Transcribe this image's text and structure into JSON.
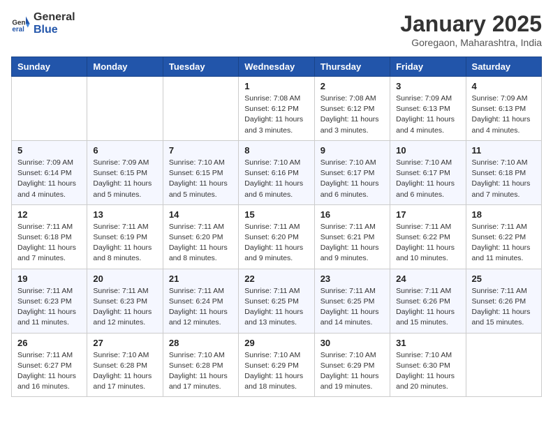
{
  "logo": {
    "general": "General",
    "blue": "Blue"
  },
  "title": "January 2025",
  "subtitle": "Goregaon, Maharashtra, India",
  "days_of_week": [
    "Sunday",
    "Monday",
    "Tuesday",
    "Wednesday",
    "Thursday",
    "Friday",
    "Saturday"
  ],
  "weeks": [
    [
      {
        "day": "",
        "info": ""
      },
      {
        "day": "",
        "info": ""
      },
      {
        "day": "",
        "info": ""
      },
      {
        "day": "1",
        "info": "Sunrise: 7:08 AM\nSunset: 6:12 PM\nDaylight: 11 hours and 3 minutes."
      },
      {
        "day": "2",
        "info": "Sunrise: 7:08 AM\nSunset: 6:12 PM\nDaylight: 11 hours and 3 minutes."
      },
      {
        "day": "3",
        "info": "Sunrise: 7:09 AM\nSunset: 6:13 PM\nDaylight: 11 hours and 4 minutes."
      },
      {
        "day": "4",
        "info": "Sunrise: 7:09 AM\nSunset: 6:13 PM\nDaylight: 11 hours and 4 minutes."
      }
    ],
    [
      {
        "day": "5",
        "info": "Sunrise: 7:09 AM\nSunset: 6:14 PM\nDaylight: 11 hours and 4 minutes."
      },
      {
        "day": "6",
        "info": "Sunrise: 7:09 AM\nSunset: 6:15 PM\nDaylight: 11 hours and 5 minutes."
      },
      {
        "day": "7",
        "info": "Sunrise: 7:10 AM\nSunset: 6:15 PM\nDaylight: 11 hours and 5 minutes."
      },
      {
        "day": "8",
        "info": "Sunrise: 7:10 AM\nSunset: 6:16 PM\nDaylight: 11 hours and 6 minutes."
      },
      {
        "day": "9",
        "info": "Sunrise: 7:10 AM\nSunset: 6:17 PM\nDaylight: 11 hours and 6 minutes."
      },
      {
        "day": "10",
        "info": "Sunrise: 7:10 AM\nSunset: 6:17 PM\nDaylight: 11 hours and 6 minutes."
      },
      {
        "day": "11",
        "info": "Sunrise: 7:10 AM\nSunset: 6:18 PM\nDaylight: 11 hours and 7 minutes."
      }
    ],
    [
      {
        "day": "12",
        "info": "Sunrise: 7:11 AM\nSunset: 6:18 PM\nDaylight: 11 hours and 7 minutes."
      },
      {
        "day": "13",
        "info": "Sunrise: 7:11 AM\nSunset: 6:19 PM\nDaylight: 11 hours and 8 minutes."
      },
      {
        "day": "14",
        "info": "Sunrise: 7:11 AM\nSunset: 6:20 PM\nDaylight: 11 hours and 8 minutes."
      },
      {
        "day": "15",
        "info": "Sunrise: 7:11 AM\nSunset: 6:20 PM\nDaylight: 11 hours and 9 minutes."
      },
      {
        "day": "16",
        "info": "Sunrise: 7:11 AM\nSunset: 6:21 PM\nDaylight: 11 hours and 9 minutes."
      },
      {
        "day": "17",
        "info": "Sunrise: 7:11 AM\nSunset: 6:22 PM\nDaylight: 11 hours and 10 minutes."
      },
      {
        "day": "18",
        "info": "Sunrise: 7:11 AM\nSunset: 6:22 PM\nDaylight: 11 hours and 11 minutes."
      }
    ],
    [
      {
        "day": "19",
        "info": "Sunrise: 7:11 AM\nSunset: 6:23 PM\nDaylight: 11 hours and 11 minutes."
      },
      {
        "day": "20",
        "info": "Sunrise: 7:11 AM\nSunset: 6:23 PM\nDaylight: 11 hours and 12 minutes."
      },
      {
        "day": "21",
        "info": "Sunrise: 7:11 AM\nSunset: 6:24 PM\nDaylight: 11 hours and 12 minutes."
      },
      {
        "day": "22",
        "info": "Sunrise: 7:11 AM\nSunset: 6:25 PM\nDaylight: 11 hours and 13 minutes."
      },
      {
        "day": "23",
        "info": "Sunrise: 7:11 AM\nSunset: 6:25 PM\nDaylight: 11 hours and 14 minutes."
      },
      {
        "day": "24",
        "info": "Sunrise: 7:11 AM\nSunset: 6:26 PM\nDaylight: 11 hours and 15 minutes."
      },
      {
        "day": "25",
        "info": "Sunrise: 7:11 AM\nSunset: 6:26 PM\nDaylight: 11 hours and 15 minutes."
      }
    ],
    [
      {
        "day": "26",
        "info": "Sunrise: 7:11 AM\nSunset: 6:27 PM\nDaylight: 11 hours and 16 minutes."
      },
      {
        "day": "27",
        "info": "Sunrise: 7:10 AM\nSunset: 6:28 PM\nDaylight: 11 hours and 17 minutes."
      },
      {
        "day": "28",
        "info": "Sunrise: 7:10 AM\nSunset: 6:28 PM\nDaylight: 11 hours and 17 minutes."
      },
      {
        "day": "29",
        "info": "Sunrise: 7:10 AM\nSunset: 6:29 PM\nDaylight: 11 hours and 18 minutes."
      },
      {
        "day": "30",
        "info": "Sunrise: 7:10 AM\nSunset: 6:29 PM\nDaylight: 11 hours and 19 minutes."
      },
      {
        "day": "31",
        "info": "Sunrise: 7:10 AM\nSunset: 6:30 PM\nDaylight: 11 hours and 20 minutes."
      },
      {
        "day": "",
        "info": ""
      }
    ]
  ]
}
